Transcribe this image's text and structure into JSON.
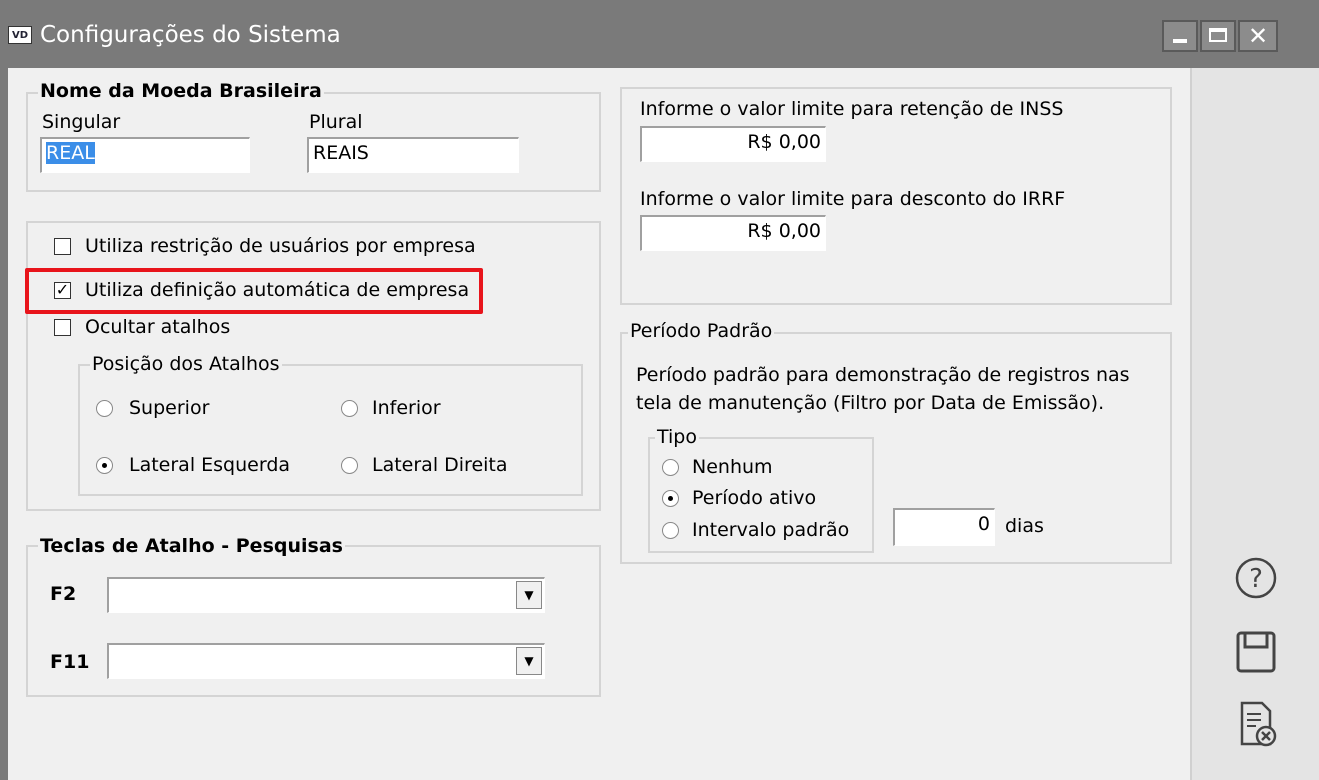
{
  "window": {
    "icon_text": "VD",
    "title": "Configurações do Sistema"
  },
  "currency": {
    "group_title": "Nome da Moeda Brasileira",
    "singular_label": "Singular",
    "singular_value": "REAL",
    "plural_label": "Plural",
    "plural_value": "REAIS"
  },
  "options": {
    "restricao_label": "Utiliza restrição de usuários por empresa",
    "restricao_checked": false,
    "definicao_label": "Utiliza definição automática de empresa",
    "definicao_checked": true,
    "ocultar_label": "Ocultar atalhos",
    "ocultar_checked": false
  },
  "shortcut_position": {
    "group_title": "Posição dos Atalhos",
    "options": [
      "Superior",
      "Inferior",
      "Lateral Esquerda",
      "Lateral Direita"
    ],
    "selected": "Lateral Esquerda"
  },
  "hotkeys": {
    "group_title": "Teclas de Atalho - Pesquisas",
    "f2_label": "F2",
    "f2_value": "",
    "f11_label": "F11",
    "f11_value": ""
  },
  "limits": {
    "inss_label": "Informe o valor limite para retenção de INSS",
    "inss_value": "R$ 0,00",
    "irrf_label": "Informe o valor limite para desconto do IRRF",
    "irrf_value": "R$ 0,00"
  },
  "period": {
    "group_title": "Período Padrão",
    "description_line1": "Período padrão para demonstração de registros nas",
    "description_line2": "tela de manutenção (Filtro por Data de Emissão).",
    "type_title": "Tipo",
    "options": [
      "Nenhum",
      "Período ativo",
      "Intervalo padrão"
    ],
    "selected": "Período ativo",
    "days_value": "0",
    "days_label": "dias"
  },
  "side_actions": {
    "help_icon": "help-icon",
    "save_icon": "save-icon",
    "cancel_icon": "cancel-document-icon"
  }
}
